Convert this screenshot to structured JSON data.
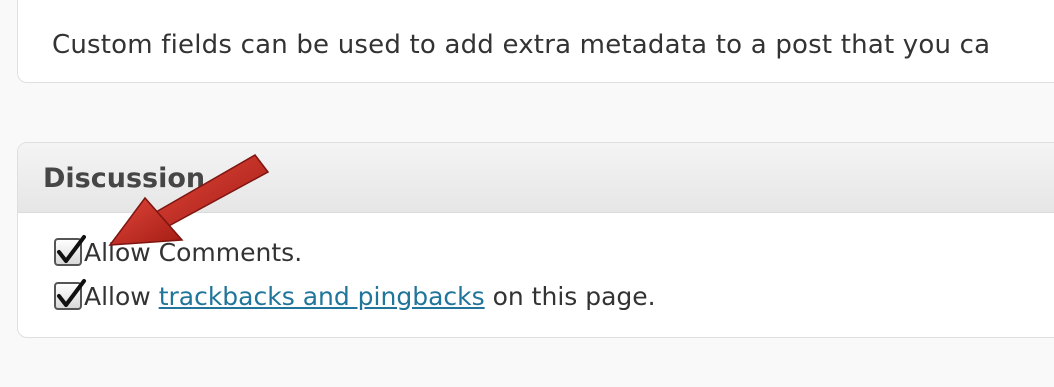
{
  "custom_fields": {
    "text": "Custom fields can be used to add extra metadata to a post that you ca"
  },
  "discussion": {
    "title": "Discussion",
    "options": [
      {
        "checked": true,
        "label": "Allow Comments."
      },
      {
        "checked": true,
        "label_prefix": "Allow ",
        "link_text": "trackbacks and pingbacks",
        "label_suffix": " on this page."
      }
    ]
  },
  "annotation": {
    "icon": "red-arrow",
    "color": "#c0281d"
  },
  "colors": {
    "link": "#21759b",
    "panel_header": "#e9e9e9",
    "panel_border": "#dfdfdf"
  }
}
